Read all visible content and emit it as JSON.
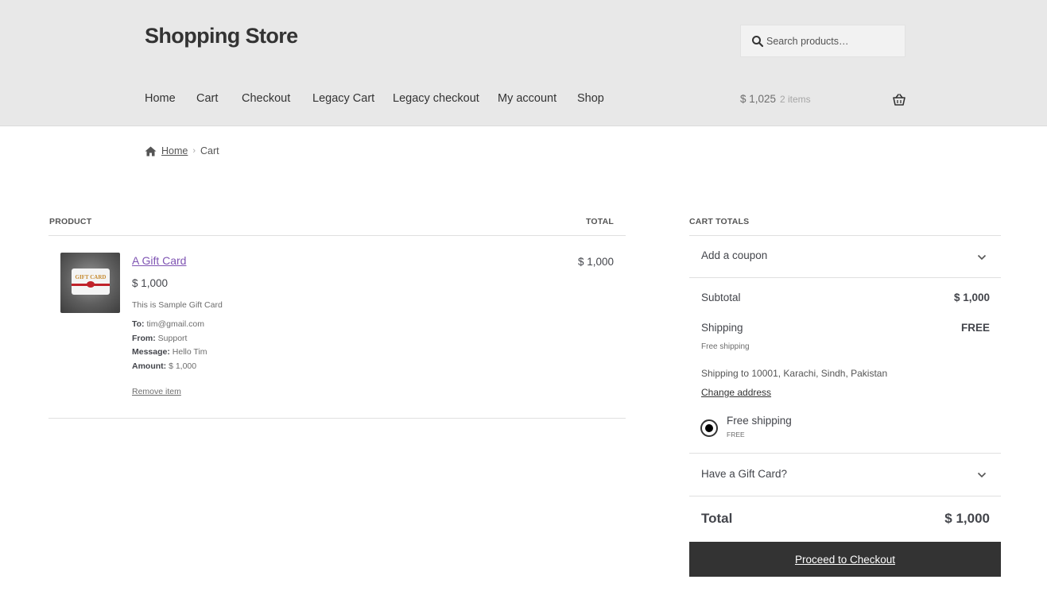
{
  "header": {
    "site_title": "Shopping Store",
    "search_placeholder": "Search products…",
    "nav": [
      "Home",
      "Cart",
      "Checkout",
      "Legacy Cart",
      "Legacy checkout",
      "My account",
      "Shop"
    ],
    "mini_cart": {
      "amount": "$ 1,025",
      "count": "2 items"
    }
  },
  "breadcrumb": {
    "home": "Home",
    "current": "Cart"
  },
  "cart": {
    "col_product": "PRODUCT",
    "col_total": "TOTAL",
    "item": {
      "thumb_text": "GIFT CARD",
      "name": "A Gift Card",
      "price": "$ 1,000",
      "description": "This is Sample Gift Card",
      "meta": [
        {
          "label": "To:",
          "value": "tim@gmail.com"
        },
        {
          "label": "From:",
          "value": "Support"
        },
        {
          "label": "Message:",
          "value": "Hello Tim"
        },
        {
          "label": "Amount:",
          "value": "$ 1,000"
        }
      ],
      "remove": "Remove item",
      "line_total": "$ 1,000"
    }
  },
  "totals": {
    "heading": "CART TOTALS",
    "coupon": "Add a coupon",
    "subtotal_label": "Subtotal",
    "subtotal_value": "$ 1,000",
    "shipping_label": "Shipping",
    "shipping_value": "FREE",
    "shipping_method": "Free shipping",
    "shipping_to": "Shipping to 10001, Karachi, Sindh, Pakistan",
    "change_address": "Change address",
    "option_label": "Free shipping",
    "option_sub": "FREE",
    "gift_card": "Have a Gift Card?",
    "total_label": "Total",
    "total_value": "$ 1,000",
    "checkout": "Proceed to Checkout"
  },
  "colors": {
    "header_bg": "#e8e8e8",
    "link": "#7f54b3",
    "button_bg": "#333333"
  }
}
